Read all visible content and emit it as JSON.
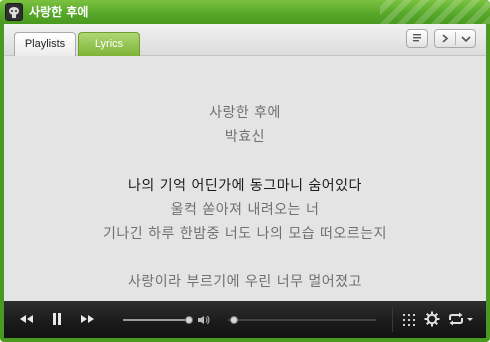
{
  "window": {
    "title": "사랑한 후에",
    "accent_color": "#57a82a"
  },
  "tabs": [
    {
      "label": "Playlists",
      "active": false
    },
    {
      "label": "Lyrics",
      "active": true
    }
  ],
  "toolbar_icons": {
    "list": "list-icon",
    "prev": "chevron-right-icon",
    "menu": "chevron-down-icon"
  },
  "lyrics": {
    "song_title": "사랑한 후에",
    "artist": "박효신",
    "lines": [
      "나의 기억 어딘가에 동그마니 숨어있다",
      "울컥 쏟아져 내려오는 너",
      "기나긴 하루 한밤중 너도 나의 모습 떠오르는지",
      "",
      "사랑이라 부르기에 우린 너무 멀어졌고"
    ],
    "current_line_index": 0
  },
  "controls": {
    "icons": [
      "rewind-icon",
      "pause-icon",
      "fast-forward-icon",
      "volume-icon",
      "grid-icon",
      "gear-icon",
      "repeat-icon"
    ],
    "seek_progress": 0.95,
    "volume_level": 0.04
  }
}
